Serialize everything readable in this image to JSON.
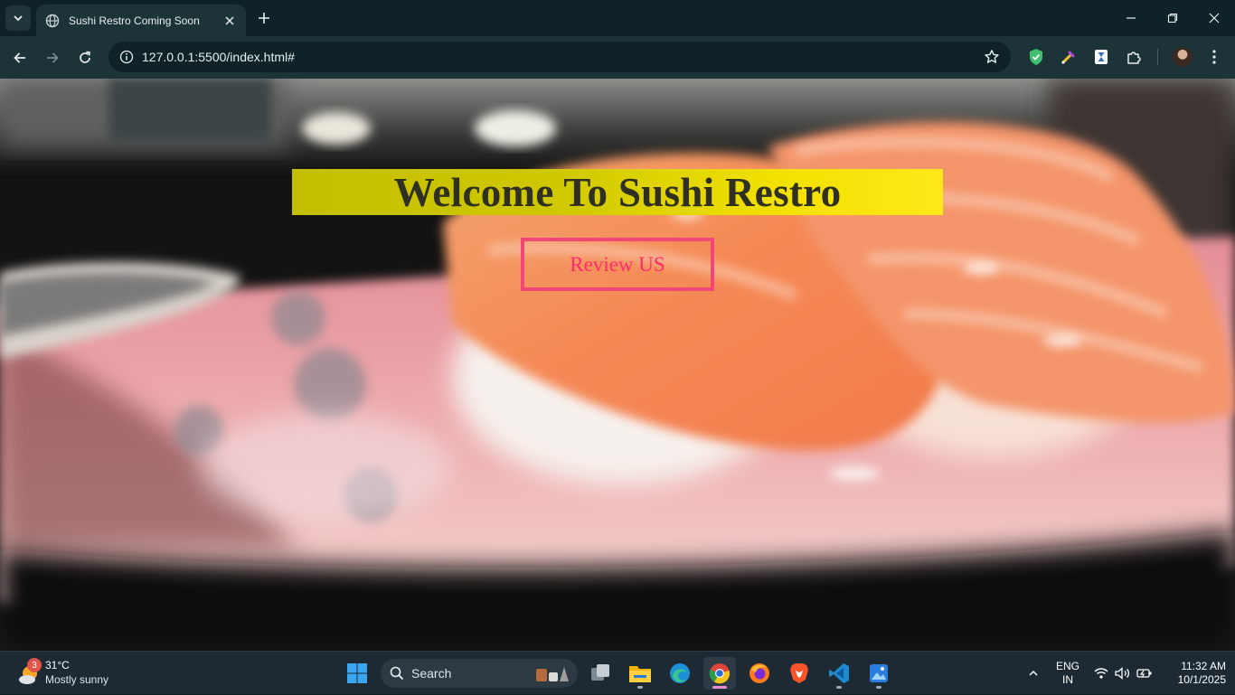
{
  "browser": {
    "tab_title": "Sushi Restro Coming Soon",
    "url": "127.0.0.1:5500/index.html#"
  },
  "page": {
    "heading": "Welcome To Sushi Restro",
    "review_button": "Review US",
    "colors": {
      "banner": "#d4cc00",
      "heading_text": "#2f3022",
      "button_border": "#f04777",
      "button_text": "#ff2c6a"
    }
  },
  "taskbar": {
    "weather": {
      "badge": "3",
      "temp": "31°C",
      "condition": "Mostly sunny"
    },
    "search_label": "Search",
    "language": [
      "ENG",
      "IN"
    ],
    "time": "11:32 AM",
    "date": "10/1/2025",
    "pinned": [
      "task-view-icon",
      "file-explorer-icon",
      "edge-icon",
      "chrome-icon",
      "firefox-icon",
      "brave-icon",
      "vscode-icon",
      "photos-icon"
    ]
  }
}
